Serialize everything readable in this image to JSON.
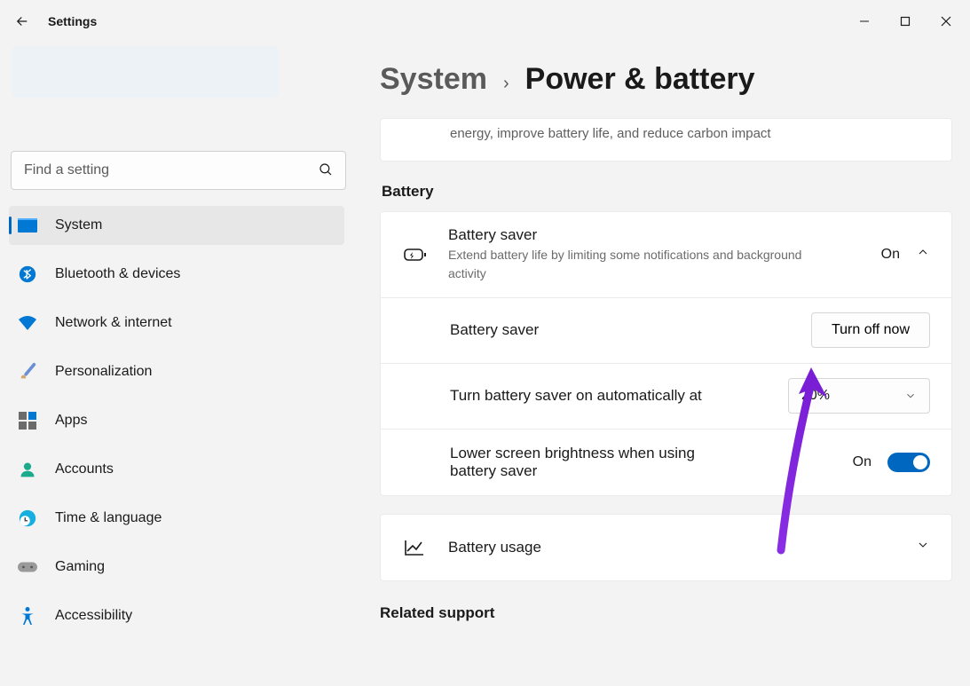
{
  "window": {
    "title": "Settings"
  },
  "search": {
    "placeholder": "Find a setting"
  },
  "sidebar": {
    "items": [
      {
        "label": "System"
      },
      {
        "label": "Bluetooth & devices"
      },
      {
        "label": "Network & internet"
      },
      {
        "label": "Personalization"
      },
      {
        "label": "Apps"
      },
      {
        "label": "Accounts"
      },
      {
        "label": "Time & language"
      },
      {
        "label": "Gaming"
      },
      {
        "label": "Accessibility"
      }
    ]
  },
  "breadcrumb": {
    "parent": "System",
    "child": "Power & battery"
  },
  "top_card": {
    "subtitle": "energy, improve battery life, and reduce carbon impact"
  },
  "battery": {
    "heading": "Battery",
    "saver": {
      "title": "Battery saver",
      "subtitle": "Extend battery life by limiting some notifications and background activity",
      "state": "On"
    },
    "turn_off": {
      "label": "Battery saver",
      "button": "Turn off now"
    },
    "auto_on": {
      "label": "Turn battery saver on automatically at",
      "value": "20%"
    },
    "brightness": {
      "label": "Lower screen brightness when using battery saver",
      "state": "On"
    },
    "usage": {
      "label": "Battery usage"
    }
  },
  "related": {
    "heading": "Related support"
  }
}
